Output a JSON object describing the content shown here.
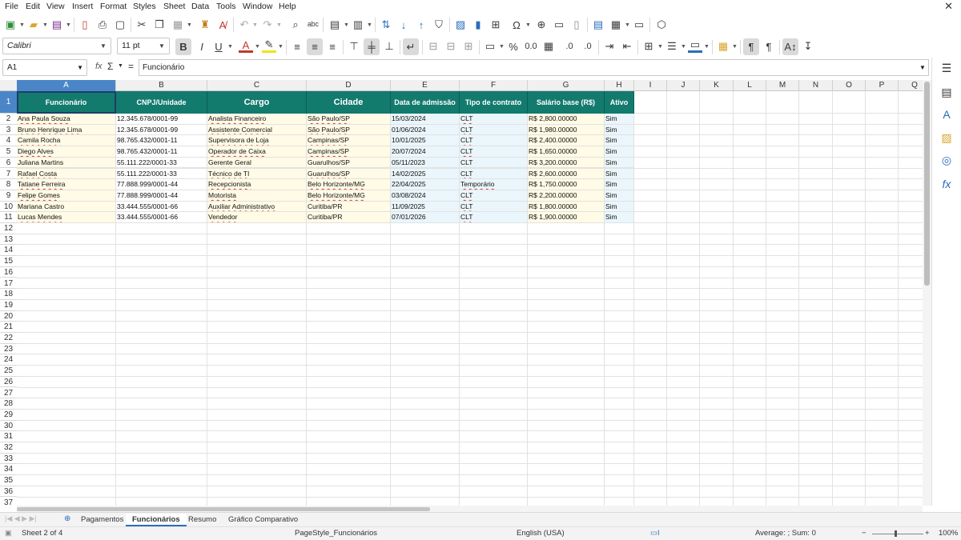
{
  "menubar": [
    "File",
    "Edit",
    "View",
    "Insert",
    "Format",
    "Styles",
    "Sheet",
    "Data",
    "Tools",
    "Window",
    "Help"
  ],
  "font": {
    "name": "Calibri",
    "size": "11 pt"
  },
  "formula_bar": {
    "cell_ref": "A1",
    "fx": "fx",
    "sum": "Σ",
    "equals": "=",
    "content": "Funcionário"
  },
  "columns": [
    "A",
    "B",
    "C",
    "D",
    "E",
    "F",
    "G",
    "H",
    "I",
    "J",
    "K",
    "L",
    "M",
    "N",
    "O",
    "P",
    "Q"
  ],
  "headers": [
    "Funcionário",
    "CNPJ/Unidade",
    "Cargo",
    "Cidade",
    "Data de admissão",
    "Tipo de contrato",
    "Salário base (R$)",
    "Ativo"
  ],
  "rows": [
    [
      "Ana Paula Souza",
      "12.345.678/0001-99",
      "Analista Financeiro",
      "São Paulo/SP",
      "15/03/2024",
      "CLT",
      "R$ 2,800.00000",
      "Sim"
    ],
    [
      "Bruno Henrique Lima",
      "12.345.678/0001-99",
      "Assistente Comercial",
      "São Paulo/SP",
      "01/06/2024",
      "CLT",
      "R$ 1,980.00000",
      "Sim"
    ],
    [
      "Camila Rocha",
      "98.765.432/0001-11",
      "Supervisora de Loja",
      "Campinas/SP",
      "10/01/2025",
      "CLT",
      "R$ 2,400.00000",
      "Sim"
    ],
    [
      "Diego Alves",
      "98.765.432/0001-11",
      "Operador de Caixa",
      "Campinas/SP",
      "20/07/2024",
      "CLT",
      "R$ 1,650.00000",
      "Sim"
    ],
    [
      "Juliana Martins",
      "55.111.222/0001-33",
      "Gerente Geral",
      "Guarulhos/SP",
      "05/11/2023",
      "CLT",
      "R$ 3,200.00000",
      "Sim"
    ],
    [
      "Rafael Costa",
      "55.111.222/0001-33",
      "Técnico de TI",
      "Guarulhos/SP",
      "14/02/2025",
      "CLT",
      "R$ 2,600.00000",
      "Sim"
    ],
    [
      "Tatiane Ferreira",
      "77.888.999/0001-44",
      "Recepcionista",
      "Belo Horizonte/MG",
      "22/04/2025",
      "Temporário",
      "R$ 1,750.00000",
      "Sim"
    ],
    [
      "Felipe Gomes",
      "77.888.999/0001-44",
      "Motorista",
      "Belo Horizonte/MG",
      "03/08/2024",
      "CLT",
      "R$ 2,200.00000",
      "Sim"
    ],
    [
      "Mariana Castro",
      "33.444.555/0001-66",
      "Auxiliar Administrativo",
      "Curitiba/PR",
      "11/09/2025",
      "CLT",
      "R$ 1,800.00000",
      "Sim"
    ],
    [
      "Lucas Mendes",
      "33.444.555/0001-66",
      "Vendedor",
      "Curitiba/PR",
      "07/01/2026",
      "CLT",
      "R$ 1,900.00000",
      "Sim"
    ]
  ],
  "row_numbers": [
    "1",
    "2",
    "3",
    "4",
    "5",
    "6",
    "7",
    "8",
    "9",
    "10",
    "11",
    "12",
    "13",
    "14",
    "15",
    "16",
    "17",
    "18",
    "19",
    "20",
    "21",
    "22",
    "23",
    "24",
    "25",
    "26",
    "27",
    "28",
    "29",
    "30",
    "31",
    "32",
    "33",
    "34",
    "35",
    "36",
    "37"
  ],
  "sheet_tabs": [
    "Pagamentos",
    "Funcionários",
    "Resumo",
    "Gráfico Comparativo"
  ],
  "active_tab": "Funcionários",
  "status": {
    "sheet": "Sheet 2 of 4",
    "page_style": "PageStyle_Funcionários",
    "language": "English (USA)",
    "sum": "Average: ; Sum: 0",
    "zoom": "100%"
  },
  "colors": {
    "header_fill": "#137a6e",
    "band_yellow": "#fffbe6",
    "band_blue": "#eaf6fb",
    "selection": "#4a86c7"
  }
}
